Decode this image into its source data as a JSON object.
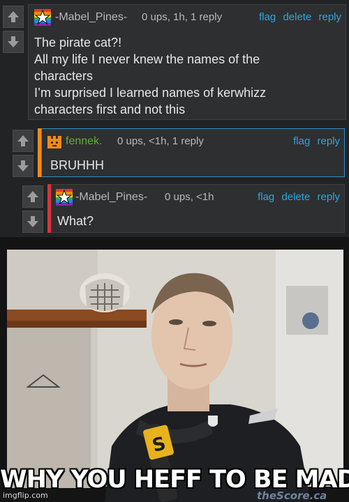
{
  "comments": [
    {
      "username": "-Mabel_Pines-",
      "meta": "0 ups, 1h, 1 reply",
      "actions": [
        "flag",
        "delete",
        "reply"
      ],
      "lines": [
        "The pirate cat?!",
        "All my life I never knew the names of the",
        "characters",
        "I’m surprised I learned names of kerwhizz",
        "characters first and not this"
      ]
    },
    {
      "username": "fennek.",
      "meta": "0 ups, <1h, 1 reply",
      "actions": [
        "flag",
        "reply"
      ],
      "lines": [
        "BRUHHH"
      ]
    },
    {
      "username": "-Mabel_Pines-",
      "meta": "0 ups, <1h",
      "actions": [
        "flag",
        "delete",
        "reply"
      ],
      "lines": [
        "What?"
      ]
    }
  ],
  "meme": {
    "caption": "WHY YOU HEFF TO BE MAD",
    "tv_logo": "theScore.ca",
    "watermark": "imgflip.com"
  },
  "colors": {
    "link": "#2aa7e0",
    "reply_bar_orange": "#f08a1c",
    "reply_bar_red": "#d8343a",
    "fennek_name": "#61b036"
  }
}
